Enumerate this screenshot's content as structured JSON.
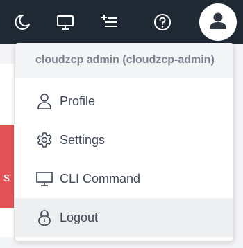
{
  "topbar": {
    "icons": [
      "moon-icon",
      "monitor-icon",
      "add-list-icon",
      "help-icon"
    ],
    "avatar_icon": "user-icon"
  },
  "background": {
    "partial_text": "s",
    "accent_color": "#e25257"
  },
  "user_menu": {
    "header": "cloudzcp admin (cloudzcp-admin)",
    "items": [
      {
        "label": "Profile",
        "icon": "user-outline-icon"
      },
      {
        "label": "Settings",
        "icon": "gear-icon"
      },
      {
        "label": "CLI Command",
        "icon": "monitor-icon"
      },
      {
        "label": "Logout",
        "icon": "lock-icon"
      }
    ]
  }
}
